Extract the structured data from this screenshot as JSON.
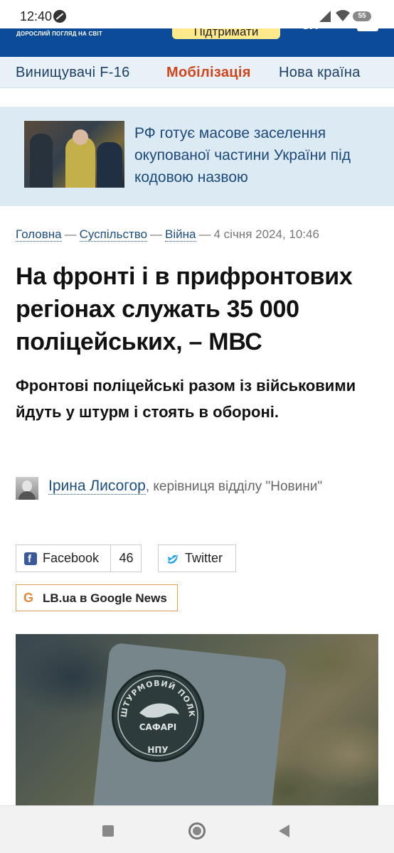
{
  "status_bar": {
    "time": "12:40",
    "battery": "55"
  },
  "site_header": {
    "tagline": "ДОРОСЛИЙ ПОГЛЯД НА СВІТ",
    "support_label": "Підтримати",
    "lang": "UA"
  },
  "topics": [
    {
      "label": "Винищувачі F-16"
    },
    {
      "label": "Мобілізація"
    },
    {
      "label": "Нова країна"
    }
  ],
  "promo": {
    "title": "РФ готує масове заселення окупованої частини України під кодовою назвою"
  },
  "breadcrumb": {
    "items": [
      "Головна",
      "Суспільство",
      "Війна"
    ],
    "separator": "—",
    "date": "4 січня 2024, 10:46"
  },
  "article": {
    "headline": "На фронті і в прифронтових регіонах служать 35 000 поліцейських, – МВС",
    "lead": "Фронтові поліцейські разом із військовими йдуть у штурм і стоять в обороні."
  },
  "author": {
    "name": "Ірина Лисогор",
    "role": ", керівниця відділу \"Новини\""
  },
  "share": {
    "facebook_label": "Facebook",
    "facebook_count": "46",
    "twitter_label": "Twitter"
  },
  "google_news": {
    "label": "LB.ua в Google News"
  },
  "photo": {
    "patch_top": "ШТУРМОВИЙ ПОЛК",
    "patch_mid": "САФАРІ",
    "patch_bottom": "НПУ"
  },
  "colors": {
    "header_bg": "#0c4b97",
    "topic_hot": "#d1451b",
    "link": "#1d4e80",
    "promo_bg": "#dceaf4"
  }
}
